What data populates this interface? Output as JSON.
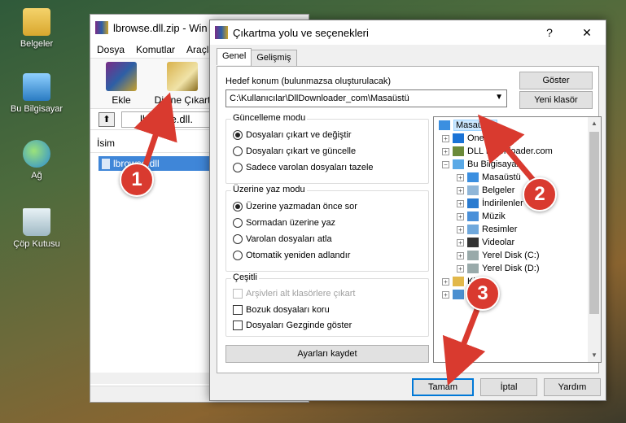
{
  "desktop": {
    "icons": [
      {
        "label": "Belgeler",
        "icon": "folder-icon"
      },
      {
        "label": "Bu Bilgisayar",
        "icon": "computer-icon"
      },
      {
        "label": "Ağ",
        "icon": "network-icon"
      },
      {
        "label": "Çöp Kutusu",
        "icon": "recycle-bin-icon"
      }
    ]
  },
  "winrar": {
    "title": "lbrowse.dll.zip - Win",
    "menu": [
      "Dosya",
      "Komutlar",
      "Araçla"
    ],
    "toolbar": {
      "add_label": "Ekle",
      "extract_label": "Dizine Çıkart"
    },
    "path": "lbrowse.dll.",
    "column_name": "İsim",
    "file": "lbrowse.dll"
  },
  "dialog": {
    "title": "Çıkartma yolu ve seçenekleri",
    "help_glyph": "?",
    "close_glyph": "✕",
    "tabs": [
      "Genel",
      "Gelişmiş"
    ],
    "destination_label": "Hedef konum (bulunmazsa oluşturulacak)",
    "destination_value": "C:\\Kullanıcılar\\DllDownloader_com\\Masaüstü",
    "show_button": "Göster",
    "new_folder_button": "Yeni klasör",
    "update_mode": {
      "title": "Güncelleme modu",
      "options": [
        "Dosyaları çıkart ve değiştir",
        "Dosyaları çıkart ve güncelle",
        "Sadece varolan dosyaları tazele"
      ],
      "selected": 0
    },
    "overwrite_mode": {
      "title": "Üzerine yaz modu",
      "options": [
        "Üzerine yazmadan önce sor",
        "Sormadan üzerine yaz",
        "Varolan dosyaları atla",
        "Otomatik yeniden adlandır"
      ],
      "selected": 0
    },
    "misc": {
      "title": "Çeşitli",
      "options": [
        "Arşivleri alt klasörlere çıkart",
        "Bozuk dosyaları koru",
        "Dosyaları Gezginde göster"
      ]
    },
    "save_settings_button": "Ayarları kaydet",
    "tree": [
      {
        "label": "Masaüstü",
        "icon": "desktop-icon",
        "selected": true
      },
      {
        "label": "OneDr",
        "icon": "onedrive-icon"
      },
      {
        "label": "DLL Downloader.com",
        "icon": "user-icon"
      },
      {
        "label": "Bu Bilgisayar",
        "icon": "computer-icon"
      },
      {
        "label": "Masaüstü",
        "icon": "desktop-icon"
      },
      {
        "label": "Belgeler",
        "icon": "documents-icon"
      },
      {
        "label": "İndirilenler",
        "icon": "download-icon"
      },
      {
        "label": "Müzik",
        "icon": "music-icon"
      },
      {
        "label": "Resimler",
        "icon": "pictures-icon"
      },
      {
        "label": "Videolar",
        "icon": "videos-icon"
      },
      {
        "label": "Yerel Disk (C:)",
        "icon": "drive-icon"
      },
      {
        "label": "Yerel Disk (D:)",
        "icon": "drive-icon"
      },
      {
        "label": "Kit",
        "icon": "libraries-icon"
      },
      {
        "label": "A",
        "icon": "network-icon"
      }
    ],
    "ok_button": "Tamam",
    "cancel_button": "İptal",
    "help_button": "Yardım"
  },
  "annotations": [
    "1",
    "2",
    "3"
  ],
  "colors": {
    "marker": "#d93a2f",
    "selection": "#3f86d8"
  }
}
